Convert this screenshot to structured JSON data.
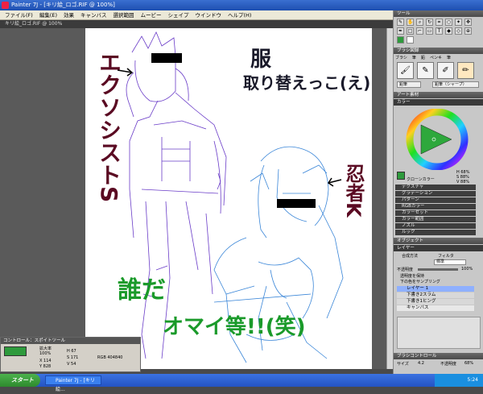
{
  "window": {
    "title": "Painter 7J - [キリ絵_ロゴ.RIF @ 100%]",
    "doc_tab": "キリ絵_ロゴ.RIF @ 100%"
  },
  "menu": [
    "ファイル(F)",
    "編集(E)",
    "効果",
    "キャンバス",
    "選択範囲",
    "ムービー",
    "シェイプ",
    "ウインドウ",
    "ヘルプ(H)"
  ],
  "palette": {
    "tools_title": "ツール",
    "brush_title": "ブラシ図録",
    "brush_tabs": [
      "ブラシ",
      "筆",
      "鉛",
      "ペンキ",
      "筆",
      "鉛筆"
    ],
    "brush_category": "鉛筆",
    "brush_variant": "鉛筆（シャープ）",
    "art_title": "アート素材",
    "color_title": "カラー",
    "clone_label": "クローンカラー",
    "hsv": [
      "H 68%",
      "S 88%",
      "V 88%"
    ],
    "lists": [
      "テクスチャ",
      "グラデーション",
      "パターン",
      "RGBカラー",
      "カラーセット",
      "カラー範囲",
      "ノズル",
      "ルック"
    ],
    "objects_title": "オブジェクト",
    "layers_title": "レイヤー",
    "composite_label": "合成方法",
    "composite_value": "標準",
    "depth_label": "フィルタ",
    "opacity_label": "不透明度",
    "opacity_value": "100%",
    "check1": "透明度を保持",
    "check2": "下の色をサンプリング",
    "layers": [
      "レイヤー 1",
      "下書き2スラム",
      "下書き1ヒング",
      "キャンバス"
    ],
    "brush_control_title": "ブラシコントロール",
    "size_label": "サイズ",
    "size_value": "4.2",
    "mode_label": "不透明度",
    "mode_value": "68%"
  },
  "control": {
    "title": "コントロール：スポイトツール",
    "zoom_label": "拡大率",
    "zoom_value": "100%",
    "x_value": "X 114",
    "y_value": "Y 828",
    "h_value": "H 67",
    "s_value": "S 171",
    "v_value": "V 54",
    "rgb_value": "RGB 404840",
    "swatch_color": "#2e9a3c"
  },
  "canvas_text": {
    "left_vertical": "エクソシストS",
    "top_right_1": "服",
    "top_right_2": "取り替えっこ(え)",
    "ninja": "忍者K",
    "bottom_1": "誰だ",
    "bottom_2": "オマイ等!!(笑)"
  },
  "taskbar": {
    "start": "スタート",
    "item": "Painter 7J - [キリ絵...",
    "clock": "5:24"
  },
  "colors": {
    "purple_sketch": "#6a3cc8",
    "blue_sketch": "#3a86d8",
    "green_text": "#1a9a2a",
    "maroon_text": "#5a0a22"
  }
}
